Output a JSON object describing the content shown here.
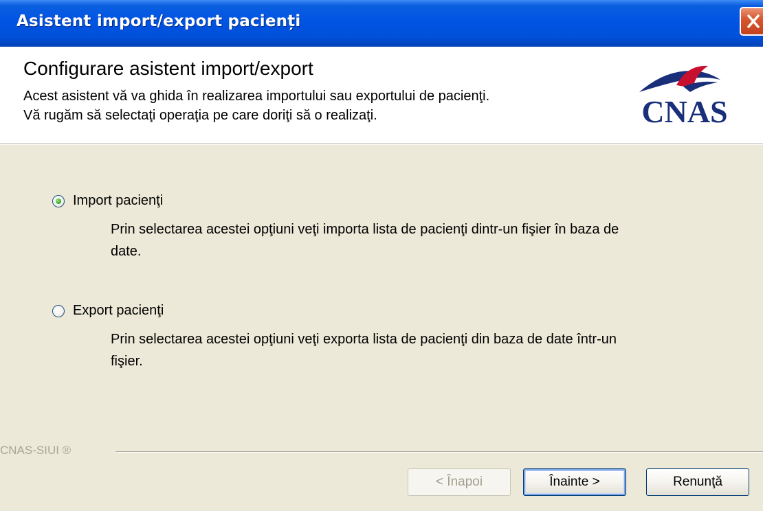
{
  "window": {
    "title": "Asistent import/export pacienți"
  },
  "header": {
    "title": "Configurare asistent import/export",
    "description_line1": "Acest asistent vă va ghida în realizarea importului sau exportului de pacienţi.",
    "description_line2": "Vă rugăm să selectaţi operaţia pe care doriţi să o realizaţi.",
    "logo_text": "CNAS"
  },
  "options": [
    {
      "label": "Import pacienţi",
      "description_line1": "Prin selectarea acestei opţiuni veţi importa lista de pacienţi dintr-un fişier în baza de",
      "description_line2": "date.",
      "selected": true
    },
    {
      "label": "Export pacienţi",
      "description_line1": "Prin selectarea acestei opţiuni veţi exporta lista de pacienţi din baza de date într-un",
      "description_line2": "fişier.",
      "selected": false
    }
  ],
  "footer": {
    "brand": "CNAS-SIUI ®"
  },
  "buttons": {
    "back": "< Înapoi",
    "next": "Înainte >",
    "cancel": "Renunţă"
  },
  "colors": {
    "titlebar": "#0054e3",
    "logo_red": "#c8102e",
    "logo_blue": "#1a2f7a",
    "radio_selected": "#3bb02f"
  }
}
